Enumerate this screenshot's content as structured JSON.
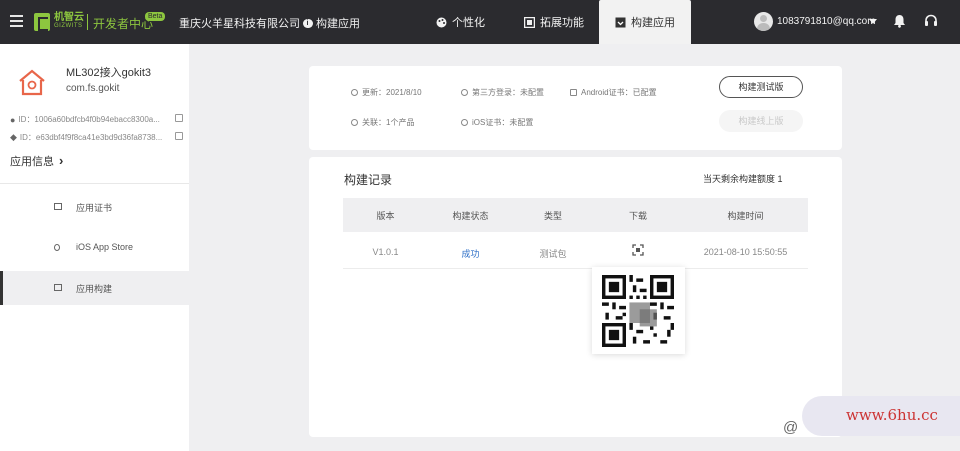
{
  "topbar": {
    "logo_cn": "机智云",
    "logo_en": "GIZWITS",
    "dev_center": "开发者中心",
    "beta": "Beta",
    "company": "重庆火羊星科技有限公司",
    "app_crumb": "构建应用",
    "tabs": [
      {
        "label": "个性化",
        "icon": "palette-icon"
      },
      {
        "label": "拓展功能",
        "icon": "extension-icon"
      },
      {
        "label": "构建应用",
        "icon": "build-icon",
        "active": true
      }
    ],
    "user_email": "1083791810@qq.com"
  },
  "sidebar": {
    "app_name": "ML302接入gokit3",
    "app_package": "com.fs.gokit",
    "ios_id": "ID：1006a60bdfcb4f0b94ebacc8300a...",
    "android_id": "ID：e63dbf4f9f8ca41e3bd9d36fa8738...",
    "app_info_link": "应用信息",
    "items": [
      {
        "label": "应用证书"
      },
      {
        "label": "iOS App Store"
      },
      {
        "label": "应用构建",
        "active": true
      }
    ]
  },
  "summary": {
    "updated": "更新：2021/8/10",
    "third_party_login": "第三方登录：未配置",
    "android_cert": "Android证书：已配置",
    "linked": "关联：1个产品",
    "ios_cert": "iOS证书：未配置",
    "btn_test_build": "构建测试版",
    "btn_release_build": "构建线上版"
  },
  "build_records": {
    "title": "构建记录",
    "quota": "当天剩余构建额度 1",
    "columns": [
      "版本",
      "构建状态",
      "类型",
      "下载",
      "构建时间"
    ],
    "rows": [
      {
        "version": "V1.0.1",
        "status": "成功",
        "type": "测试包",
        "time": "2021-08-10 15:50:55"
      }
    ]
  },
  "watermark": {
    "text": "www.6hu.cc",
    "at": "@"
  },
  "colors": {
    "topbar_bg": "#2b2b2f",
    "brand_green": "#8dc63f",
    "success_blue": "#2d6fc7",
    "watermark_red": "#cc3333"
  }
}
